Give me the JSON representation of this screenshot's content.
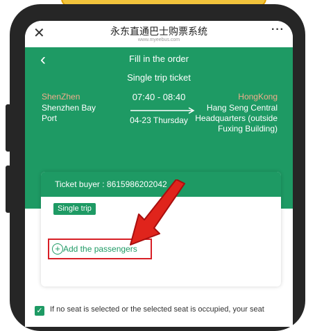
{
  "browser": {
    "title": "永东直通巴士购票系统",
    "url": "www.myeebus.com",
    "close_icon": "close-icon",
    "more_icon": "more-options-icon"
  },
  "header": {
    "back_icon": "chevron-left-icon",
    "title": "Fill in the order",
    "ticket_type": "Single trip ticket"
  },
  "route": {
    "origin_city": "ShenZhen",
    "origin_station": "Shenzhen Bay Port",
    "departure_arrival": "07:40 - 08:40",
    "date": "04-23 Thursday",
    "dest_city": "HongKong",
    "dest_station": "Hang Seng Central Headquarters (outside Fuxing Building)"
  },
  "card": {
    "buyer_label": "Ticket buyer : 8615986202042",
    "trip_label": "Single trip",
    "add_passengers_label": "Add the passengers"
  },
  "agreement": {
    "text": "If no seat is selected or the selected seat is occupied, your seat"
  },
  "colors": {
    "brand_green": "#1e9a64",
    "highlight_red": "#d81f26",
    "city_orange": "#f3ad8b"
  }
}
